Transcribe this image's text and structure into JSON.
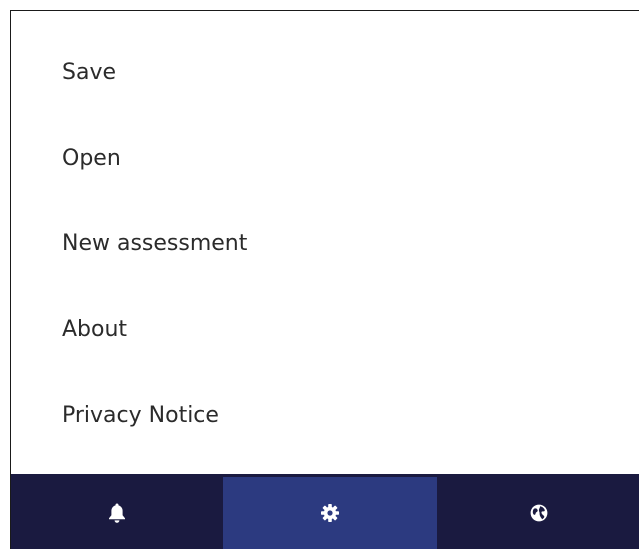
{
  "menu": {
    "items": [
      {
        "label": "Save"
      },
      {
        "label": "Open"
      },
      {
        "label": "New assessment"
      },
      {
        "label": "About"
      },
      {
        "label": "Privacy Notice"
      }
    ]
  },
  "bottom_bar": {
    "buttons": [
      {
        "icon": "bell-icon",
        "active": false
      },
      {
        "icon": "gear-icon",
        "active": true
      },
      {
        "icon": "globe-icon",
        "active": false
      }
    ],
    "colors": {
      "background": "#1a1a40",
      "active": "#2c3a80",
      "icon": "#ffffff"
    }
  }
}
